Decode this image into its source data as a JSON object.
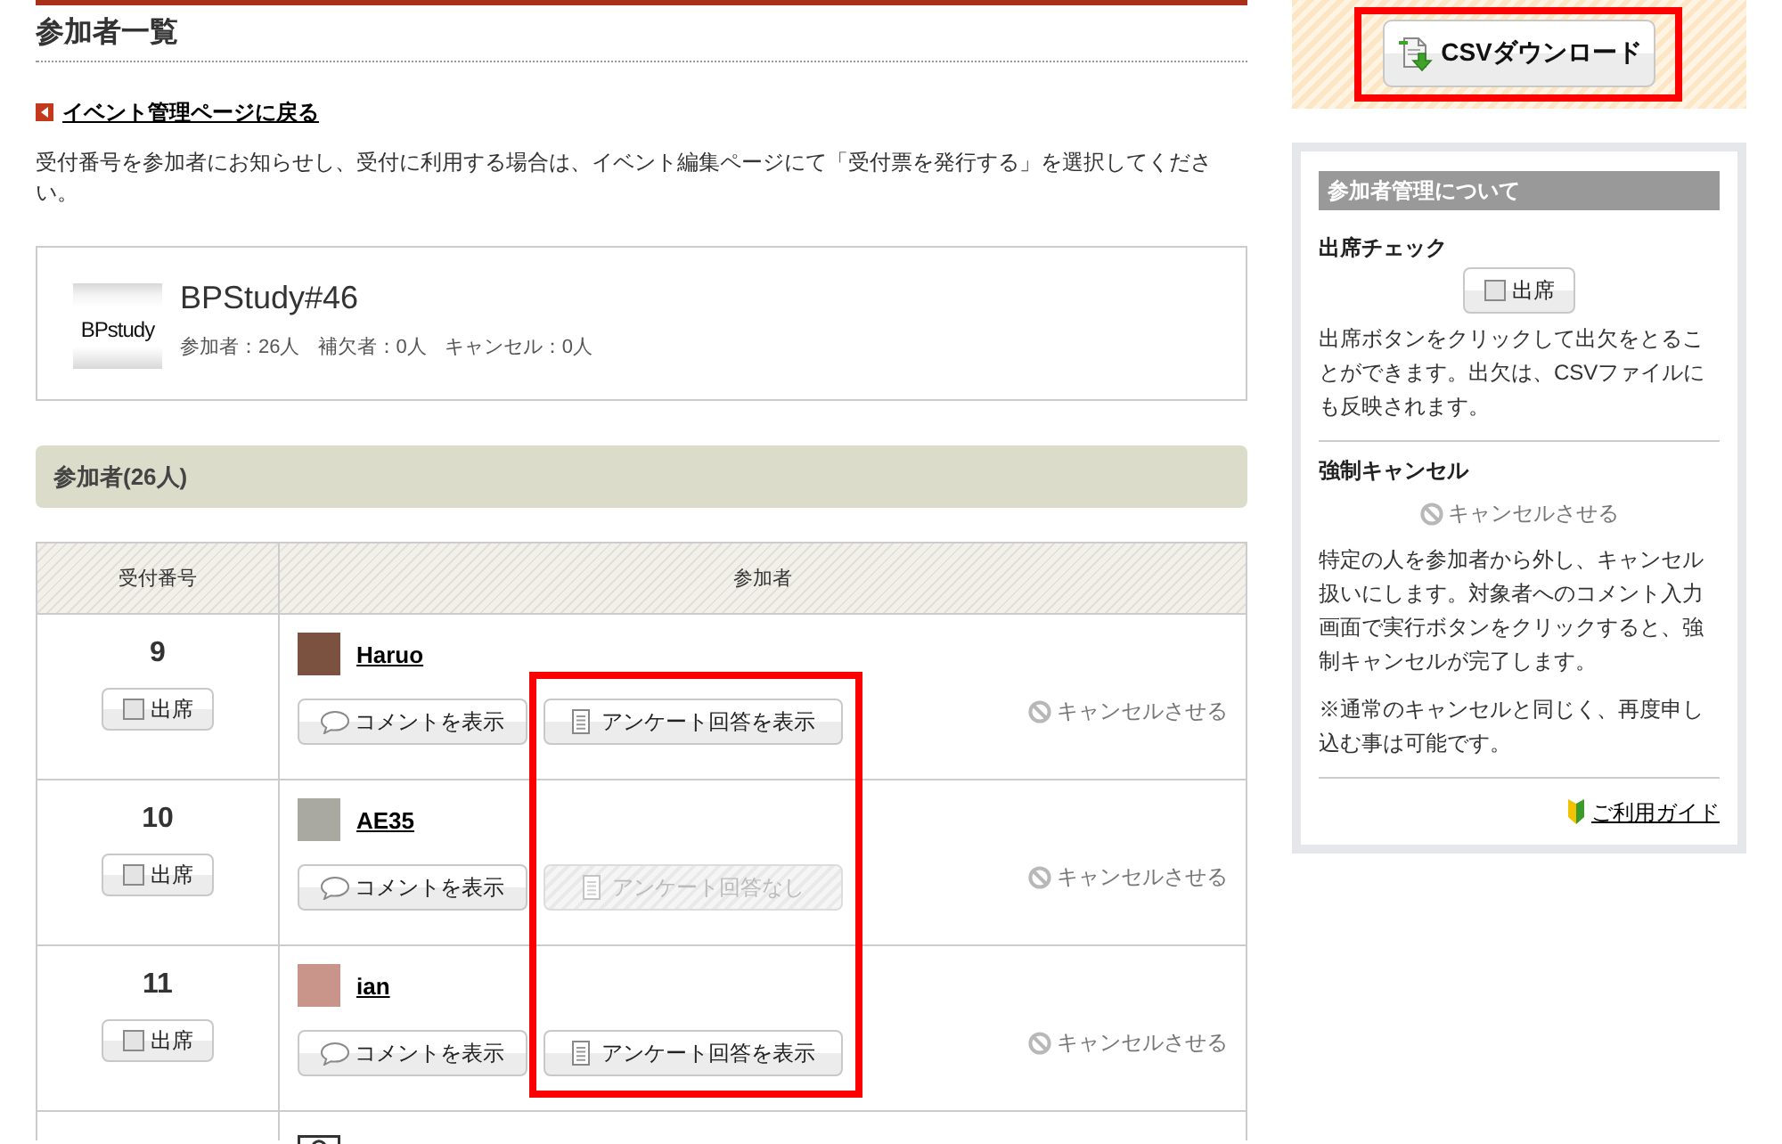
{
  "page": {
    "title": "参加者一覧"
  },
  "back_link": {
    "label": "イベント管理ページに戻る"
  },
  "description": "受付番号を参加者にお知らせし、受付に利用する場合は、イベント編集ページにて「受付票を発行する」を選択してください。",
  "event": {
    "logo": "BPstudy",
    "title": "BPStudy#46",
    "stats": [
      "参加者：26人",
      "補欠者：0人",
      "キャンセル：0人"
    ]
  },
  "section": {
    "title": "参加者(26人)"
  },
  "table": {
    "columns": [
      "受付番号",
      "参加者"
    ],
    "survey_highlighted": true,
    "rows": [
      {
        "kind": "full",
        "number": "9",
        "attendance": {
          "label": "出席",
          "checked": false
        },
        "name": "Haruo",
        "color": "#7b5240",
        "comment_button": "コメントを表示",
        "survey_button": {
          "label": "アンケート回答を表示",
          "disabled": false
        },
        "cancel_link": "キャンセルさせる"
      },
      {
        "kind": "full",
        "number": "10",
        "attendance": {
          "label": "出席",
          "checked": false
        },
        "name": "AE35",
        "color": "#a9a9a2",
        "comment_button": "コメントを表示",
        "survey_button": {
          "label": "アンケート回答なし",
          "disabled": true
        },
        "cancel_link": "キャンセルさせる"
      },
      {
        "kind": "full",
        "number": "11",
        "attendance": {
          "label": "出席",
          "checked": false
        },
        "name": "ian",
        "color": "#c9958a",
        "comment_button": "コメントを表示",
        "survey_button": {
          "label": "アンケート回答を表示",
          "disabled": false
        },
        "cancel_link": "キャンセルさせる"
      },
      {
        "kind": "partial"
      }
    ]
  },
  "sidebar": {
    "csv_button": {
      "label": "CSVダウンロード",
      "highlighted": true
    },
    "help": {
      "title": "参加者管理について",
      "sections": [
        {
          "kind": "attendance",
          "heading": "出席チェック",
          "control": {
            "label": "出席",
            "checked": false
          },
          "paragraphs": [
            "出席ボタンをクリックして出欠をとることができます。出欠は、CSVファイルにも反映されます。"
          ]
        },
        {
          "kind": "cancel",
          "heading": "強制キャンセル",
          "control": {
            "label": "キャンセルさせる"
          },
          "paragraphs": [
            "特定の人を参加者から外し、キャンセル扱いにします。対象者へのコメント入力画面で実行ボタンをクリックすると、強制キャンセルが完了します。",
            "※通常のキャンセルと同じく、再度申し込む事は可能です。"
          ]
        }
      ],
      "guide_link": "ご利用ガイド"
    }
  }
}
